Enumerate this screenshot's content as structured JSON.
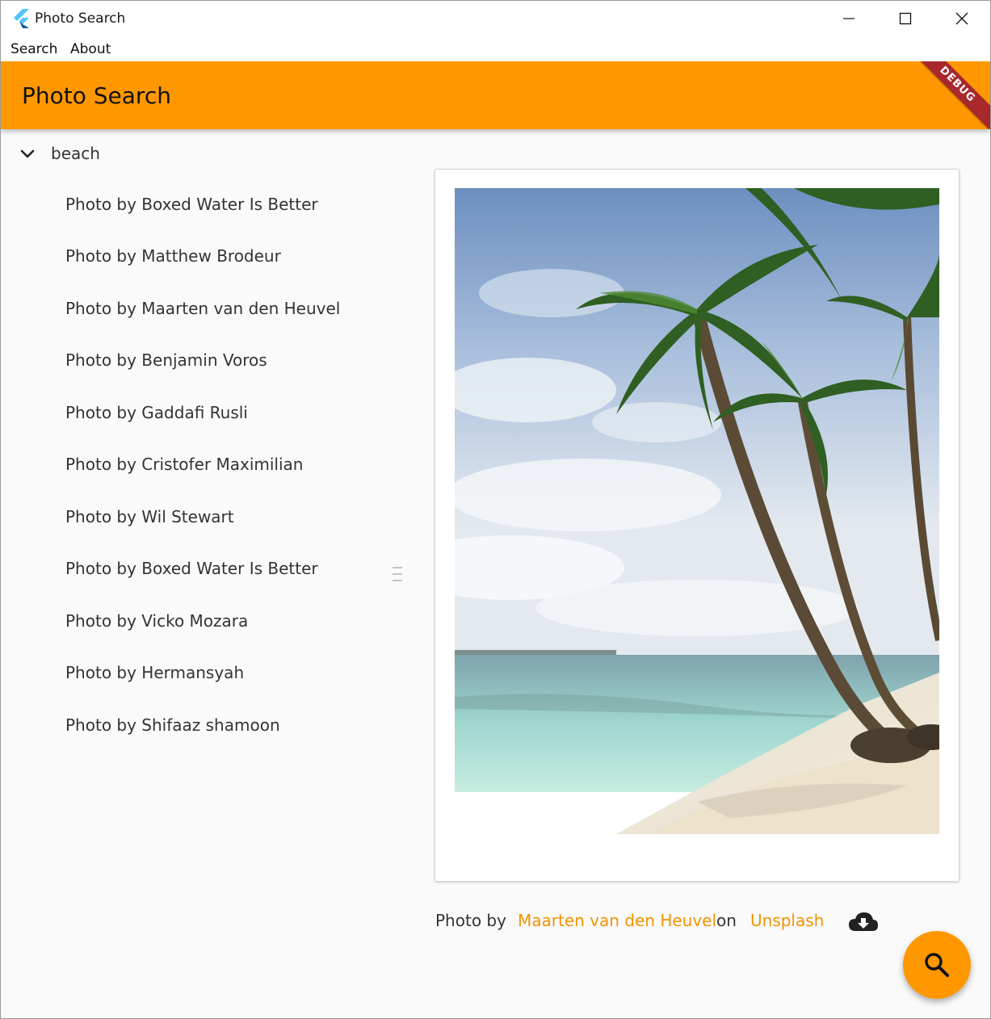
{
  "window": {
    "title": "Photo Search",
    "controls": {
      "minimize": "minimize-icon",
      "maximize": "maximize-icon",
      "close": "close-icon"
    }
  },
  "menu": {
    "items": [
      "Search",
      "About"
    ]
  },
  "appbar": {
    "title": "Photo Search",
    "debug_label": "DEBUG",
    "color": "#ff9800",
    "debug_color": "#a8282c"
  },
  "tree": {
    "label": "beach",
    "expanded": true,
    "items": [
      "Photo by Boxed Water Is Better",
      "Photo by Matthew Brodeur",
      "Photo by Maarten van den Heuvel",
      "Photo by Benjamin Voros",
      "Photo by Gaddafi Rusli",
      "Photo by Cristofer Maximilian",
      "Photo by Wil Stewart",
      "Photo by Boxed Water Is Better",
      "Photo by Vicko Mozara",
      "Photo by Hermansyah",
      "Photo by Shifaaz shamoon"
    ]
  },
  "detail": {
    "caption_prefix": "Photo by",
    "author": "Maarten van den Heuvel",
    "on": "on",
    "source": "Unsplash",
    "link_color": "#f39200",
    "download_icon": "cloud-download-icon"
  },
  "fab": {
    "icon": "search-icon",
    "color": "#ff9800"
  }
}
